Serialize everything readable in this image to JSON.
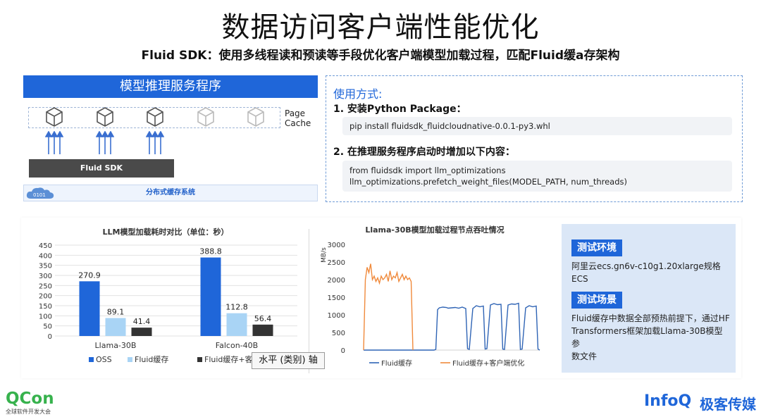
{
  "title": "数据访问客户端性能优化",
  "subtitle": "Fluid SDK：使用多线程读和预读等手段优化客户端模型加载过程，匹配Fluid缓a存架构",
  "architecture": {
    "header": "模型推理服务程序",
    "page_cache_line1": "Page",
    "page_cache_line2": "Cache",
    "sdk_label": "Fluid SDK",
    "dist_label": "分布式缓存系统"
  },
  "usage": {
    "title": "使用方式:",
    "step1": "1. 安装Python Package：",
    "code1": "pip install fluidsdk_fluidcloudnative-0.0.1-py3.whl",
    "step2": "2. 在推理服务程序启动时增加以下内容：",
    "code2_line1": "from fluidsdk import llm_optimizations",
    "code2_line2": "llm_optimizations.prefetch_weight_files(MODEL_PATH, num_threads)"
  },
  "chart_data": [
    {
      "type": "bar",
      "title": "LLM模型加载耗时对比（单位：秒）",
      "categories": [
        "Llama-30B",
        "Falcon-40B"
      ],
      "series": [
        {
          "name": "OSS",
          "values": [
            270.9,
            388.8
          ],
          "color": "#1f66d9"
        },
        {
          "name": "Fluid缓存",
          "values": [
            89.1,
            112.8
          ],
          "color": "#a9d4f5"
        },
        {
          "name": "Fluid缓存+客户端优化",
          "values": [
            41.4,
            56.4
          ],
          "color": "#333333"
        }
      ],
      "ylim": [
        0,
        450
      ],
      "yticks": [
        "0",
        "50",
        "100",
        "150",
        "200",
        "250",
        "300",
        "350",
        "400",
        "450"
      ],
      "data_labels": [
        "270.9",
        "89.1",
        "41.4",
        "388.8",
        "112.8",
        "56.4"
      ],
      "legend": "bottom",
      "grid": true
    },
    {
      "type": "line",
      "title": "Llama-30B模型加载过程节点吞吐情况",
      "ylabel": "MB/s",
      "ylim": [
        0,
        3000
      ],
      "yticks": [
        "0",
        "500",
        "1000",
        "1500",
        "2000",
        "2500",
        "3000"
      ],
      "legend": "bottom",
      "series": [
        {
          "name": "Fluid缓存",
          "color": "#2f64b5",
          "x": [
            0,
            5,
            10,
            12,
            14,
            16,
            18,
            20,
            22,
            23,
            25,
            27,
            28,
            30,
            32,
            34,
            36,
            38,
            40,
            41,
            42,
            43,
            45,
            47,
            48,
            50,
            52,
            54,
            56,
            58,
            59,
            60,
            62,
            64,
            66,
            68,
            69,
            70,
            72,
            74,
            76,
            78,
            79,
            80,
            82,
            84,
            86,
            88,
            89,
            90,
            92,
            94,
            96,
            98,
            99,
            100
          ],
          "y": [
            0,
            0,
            0,
            0,
            0,
            0,
            0,
            0,
            0,
            0,
            0,
            0,
            0,
            0,
            0,
            0,
            0,
            0,
            0,
            20,
            1150,
            1200,
            1220,
            1210,
            1190,
            1200,
            1210,
            1190,
            1220,
            1180,
            40,
            20,
            1180,
            1260,
            1230,
            1250,
            30,
            40,
            1280,
            1320,
            1290,
            1300,
            30,
            20,
            1280,
            1310,
            1300,
            1330,
            20,
            30,
            1200,
            1260,
            1230,
            1250,
            30,
            0
          ]
        },
        {
          "name": "Fluid缓存+客户端优化",
          "color": "#f08a3c",
          "x": [
            0,
            1,
            2,
            3,
            4,
            5,
            6,
            7,
            8,
            9,
            10,
            11,
            12,
            13,
            14,
            15,
            16,
            17,
            18,
            19,
            20,
            21,
            22,
            23,
            24,
            25,
            26,
            27,
            28
          ],
          "y": [
            0,
            2000,
            2350,
            2200,
            2450,
            2000,
            2100,
            1950,
            2050,
            1900,
            2100,
            2000,
            2050,
            2150,
            1950,
            2250,
            2000,
            2100,
            2050,
            2200,
            1950,
            2050,
            2150,
            2000,
            2100,
            2000,
            2050,
            1950,
            0
          ]
        }
      ]
    }
  ],
  "environment": {
    "tag1": "测试环境",
    "text1": "阿里云ecs.gn6v-c10g1.20xlarge规格ECS",
    "tag2": "测试场景",
    "text2_line1": "Fluid缓存中数据全部预热前提下，通过HF",
    "text2_line2": "Transformers框架加载Llama-30B模型参",
    "text2_line3": "数文件"
  },
  "tooltip": "水平 (类别) 轴",
  "footer": {
    "qcon": "QCon",
    "qcon_sub": "全球软件开发大会",
    "infoq": "InfoQ",
    "brand": "极客传媒"
  }
}
